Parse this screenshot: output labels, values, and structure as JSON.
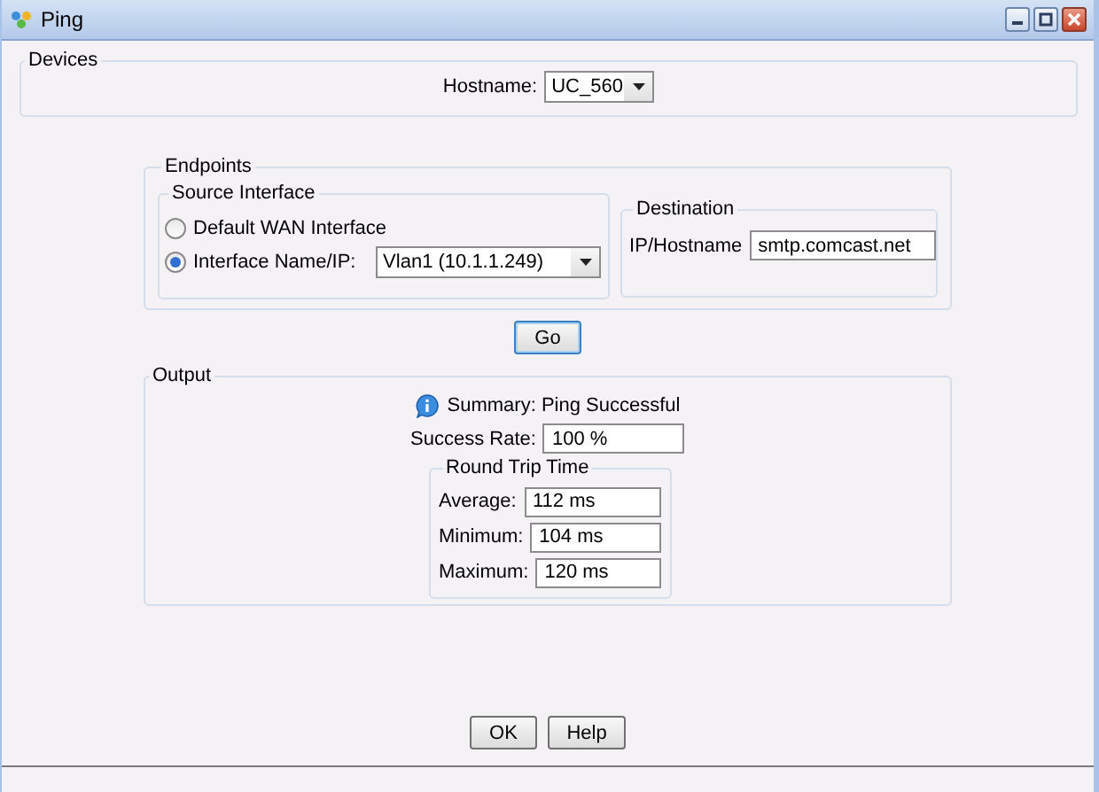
{
  "window": {
    "title": "Ping"
  },
  "devices": {
    "legend": "Devices",
    "hostname_label": "Hostname:",
    "hostname": "UC_560"
  },
  "endpoints": {
    "legend": "Endpoints",
    "source": {
      "legend": "Source Interface",
      "options": [
        {
          "label": "Default WAN Interface",
          "selected": false
        },
        {
          "label": "Interface Name/IP:",
          "selected": true
        }
      ],
      "interface": "Vlan1 (10.1.1.249)"
    },
    "destination": {
      "legend": "Destination",
      "label": "IP/Hostname",
      "value": "smtp.comcast.net"
    }
  },
  "go_button": "Go",
  "output": {
    "legend": "Output",
    "summary": "Summary: Ping Successful",
    "success_rate_label": "Success Rate:",
    "success_rate": "100 %",
    "round_trip": {
      "legend": "Round Trip Time",
      "rows": [
        {
          "label": "Average:",
          "value": "112 ms"
        },
        {
          "label": "Minimum:",
          "value": "104 ms"
        },
        {
          "label": "Maximum:",
          "value": "120 ms"
        }
      ]
    }
  },
  "buttons": [
    "OK",
    "Help"
  ]
}
